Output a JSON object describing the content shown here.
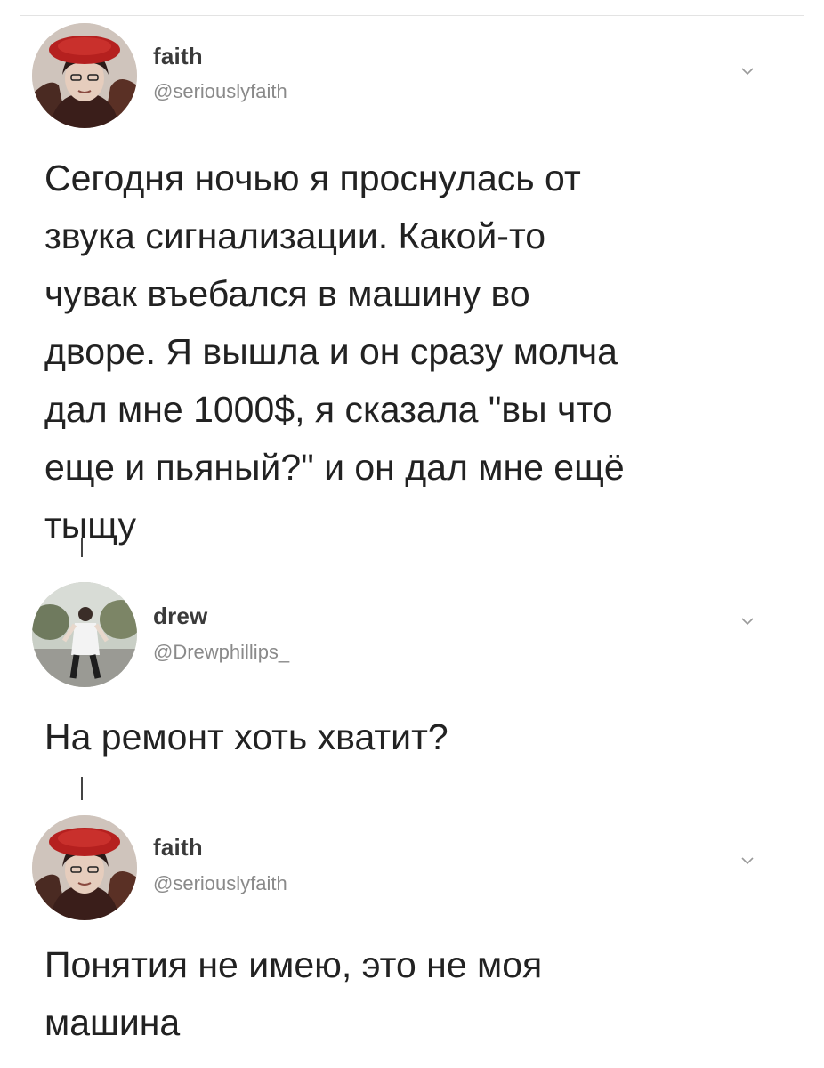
{
  "tweets": [
    {
      "name": "faith",
      "handle": "@seriouslyfaith",
      "text": "Сегодня ночью я проснулась от\nзвука сигнализации. Какой-то\nчувак въебался в машину во\nдворе. Я вышла и он сразу молча\nдал мне 1000$, я сказала \"вы что\nеще и пьяный?\" и он дал мне ещё\nтыщу",
      "avatar_icon": "avatar-red-beret-photo",
      "menu_icon": "chevron-down-icon"
    },
    {
      "name": "drew",
      "handle": "@Drewphillips_",
      "text": "На ремонт хоть хватит?",
      "avatar_icon": "avatar-person-outdoors-photo",
      "menu_icon": "chevron-down-icon"
    },
    {
      "name": "faith",
      "handle": "@seriouslyfaith",
      "text": "Понятия не имею, это не моя\nмашина",
      "avatar_icon": "avatar-red-beret-photo",
      "menu_icon": "chevron-down-icon"
    }
  ],
  "colors": {
    "text": "#222222",
    "name": "#3a3a3a",
    "handle": "#8a8a8a",
    "thread_line": "#444444",
    "beret": "#b5201f"
  }
}
